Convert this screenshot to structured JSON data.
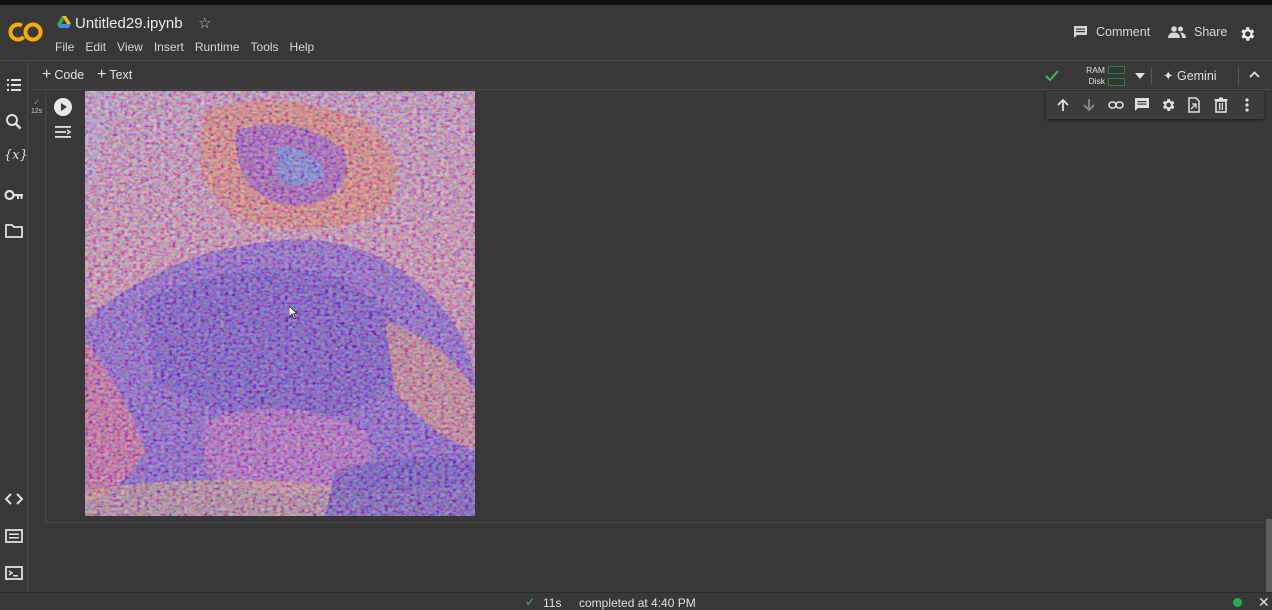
{
  "header": {
    "logo_text": "CO",
    "notebook_title": "Untitled29.ipynb",
    "menu": [
      "File",
      "Edit",
      "View",
      "Insert",
      "Runtime",
      "Tools",
      "Help"
    ],
    "comment_label": "Comment",
    "share_label": "Share"
  },
  "toolbar": {
    "add_code_label": "Code",
    "add_text_label": "Text",
    "ram_label": "RAM",
    "disk_label": "Disk",
    "gemini_label": "Gemini"
  },
  "cell": {
    "exec_time": "12s"
  },
  "statusbar": {
    "elapsed": "11s",
    "message": "completed at 4:40 PM"
  },
  "colors": {
    "accent_orange": "#f9ab00",
    "status_green": "#1fb24a",
    "background": "#383838"
  }
}
